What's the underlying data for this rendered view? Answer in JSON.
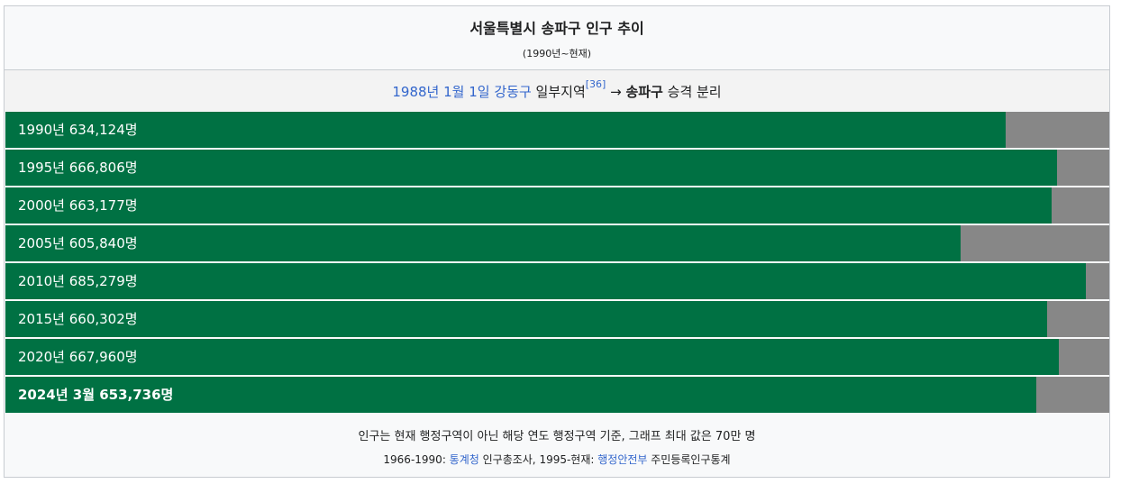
{
  "header": {
    "title": "서울특별시 송파구 인구 추이",
    "subtitle": "(1990년~현재)"
  },
  "note": {
    "date_link": "1988년 1월 1일",
    "district_link": "강동구",
    "text_mid": "일부지역",
    "ref": "[36]",
    "arrow": " → ",
    "new_name": "송파구",
    "text_end": "승격 분리"
  },
  "chart_data": {
    "type": "bar",
    "orientation": "horizontal",
    "xlim": [
      0,
      700000
    ],
    "categories": [
      "1990년",
      "1995년",
      "2000년",
      "2005년",
      "2010년",
      "2015년",
      "2020년",
      "2024년 3월"
    ],
    "values": [
      634124,
      666806,
      663177,
      605840,
      685279,
      660302,
      667960,
      653736
    ],
    "labels": [
      "1990년 634,124명",
      "1995년 666,806명",
      "2000년 663,177명",
      "2005년 605,840명",
      "2010년 685,279명",
      "2015년 660,302명",
      "2020년 667,960명",
      "2024년 3월 653,736명"
    ],
    "colors": {
      "fill": "#007143",
      "track": "#878787"
    }
  },
  "footer": {
    "line1": "인구는 현재 행정구역이 아닌 해당 연도 행정구역 기준, 그래프 최대 값은 70만 명",
    "line2_pre": "1966-1990: ",
    "line2_link1": "통계청",
    "line2_mid": " 인구총조사, 1995-현재: ",
    "line2_link2": "행정안전부",
    "line2_end": " 주민등록인구통계"
  }
}
